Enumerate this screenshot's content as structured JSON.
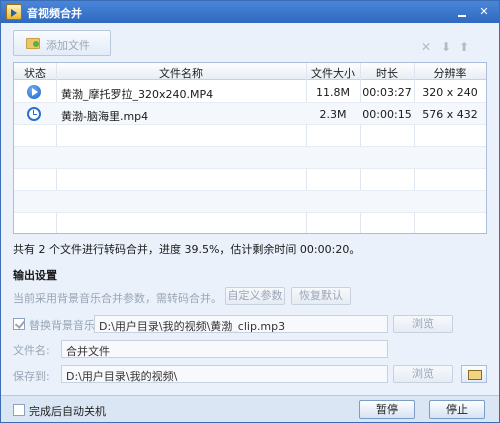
{
  "window": {
    "title": "音视频合并"
  },
  "toolbar": {
    "add_label": "添加文件",
    "icons": [
      "close-icon",
      "arrow-down-icon",
      "arrow-up-icon"
    ]
  },
  "list": {
    "columns": [
      "状态",
      "文件名称",
      "文件大小",
      "时长",
      "分辨率"
    ],
    "rows": [
      {
        "status": "converting",
        "name": "黄渤_摩托罗拉_320x240.MP4",
        "size": "11.8M",
        "duration": "00:03:27",
        "resolution": "320 x 240"
      },
      {
        "status": "waiting",
        "name": "黄渤-脑海里.mp4",
        "size": "2.3M",
        "duration": "00:00:15",
        "resolution": "576 x 432"
      }
    ]
  },
  "summary": "共有 2 个文件进行转码合并，进度 39.5%，估计剩余时间 00:00:20。",
  "output": {
    "title": "输出设置",
    "hint": "当前采用背景音乐合并参数，需转码合并。",
    "custom_params": "自定义参数",
    "restore_default": "恢复默认",
    "replace_music_label": "替换背景音乐",
    "music_path": "D:\\用户目录\\我的视频\\黄渤_clip.mp3",
    "browse1": "浏览",
    "filename_label": "文件名:",
    "filename": "合并文件",
    "save_label": "保存到:",
    "save_path": "D:\\用户目录\\我的视频\\",
    "browse2": "浏览"
  },
  "bottom": {
    "auto_shutdown": "完成后自动关机",
    "pause": "暂停",
    "stop": "停止"
  }
}
